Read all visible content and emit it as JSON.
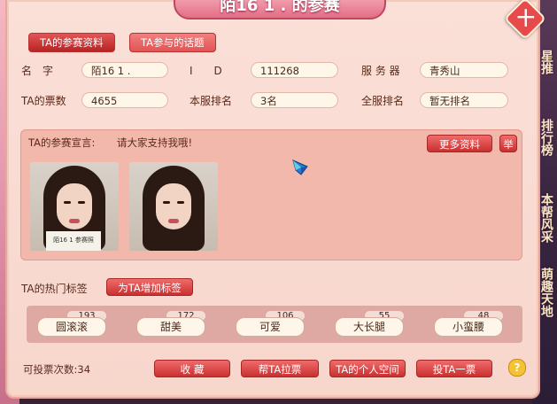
{
  "window": {
    "title": "陌16 1 . 的参赛",
    "close_symbol": "十"
  },
  "tabs": [
    {
      "label": "TA的参赛资料",
      "active": true
    },
    {
      "label": "TA参与的话题",
      "active": false
    }
  ],
  "profile": {
    "name_label": "名　字",
    "name_value": "陌16 1 .",
    "id_label": "I　　D",
    "id_value": "111268",
    "server_label": "服 务 器",
    "server_value": "青秀山",
    "votes_label": "TA的票数",
    "votes_value": "4655",
    "server_rank_label": "本服排名",
    "server_rank_value": "3名",
    "global_rank_label": "全服排名",
    "global_rank_value": "暂无排名"
  },
  "declaration": {
    "label": "TA的参赛宣言:",
    "text": "请大家支持我哦!",
    "more_button": "更多资料",
    "report_button": "举",
    "photo_card_text": "陌16 1 参赛照"
  },
  "tags": {
    "label": "TA的热门标签",
    "add_button": "为TA增加标签",
    "items": [
      {
        "name": "圆滚滚",
        "count": "193"
      },
      {
        "name": "甜美",
        "count": "172"
      },
      {
        "name": "可爱",
        "count": "106"
      },
      {
        "name": "大长腿",
        "count": "55"
      },
      {
        "name": "小蛮腰",
        "count": "48"
      }
    ]
  },
  "footer": {
    "remaining_votes": "可投票次数:34",
    "favorite_button": "收 藏",
    "canvass_button": "帮TA拉票",
    "space_button": "TA的个人空间",
    "vote_button": "投TA一票",
    "help_symbol": "?"
  },
  "side_menu": {
    "items": [
      "星推",
      "排行榜",
      "本帮风采",
      "萌趣天地"
    ]
  },
  "colors": {
    "accent": "#c93030",
    "panel": "#f7d6cc",
    "banner": "#e36e86"
  }
}
